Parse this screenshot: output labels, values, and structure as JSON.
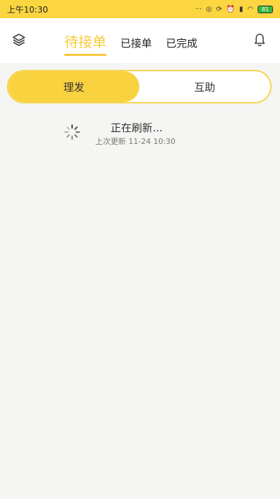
{
  "status_bar": {
    "time": "上午10:30",
    "icons": [
      "dots-icon",
      "location-icon",
      "sync-icon",
      "alarm-icon",
      "signal-icon",
      "wifi-icon",
      "battery-icon"
    ],
    "battery": "81",
    "bg_color": "#fcd640"
  },
  "header": {
    "left_icon": "layers-icon",
    "right_icon": "bell-icon",
    "tabs": [
      {
        "label": "待接单",
        "active": true
      },
      {
        "label": "已接单",
        "active": false
      },
      {
        "label": "已完成",
        "active": false
      }
    ],
    "accent_color": "#f6c93a"
  },
  "segment": {
    "items": [
      {
        "label": "理发",
        "active": true
      },
      {
        "label": "互助",
        "active": false
      }
    ]
  },
  "refresh": {
    "title": "正在刷新...",
    "last_update": "上次更新 11-24 10:30",
    "icon": "spinner-icon"
  }
}
